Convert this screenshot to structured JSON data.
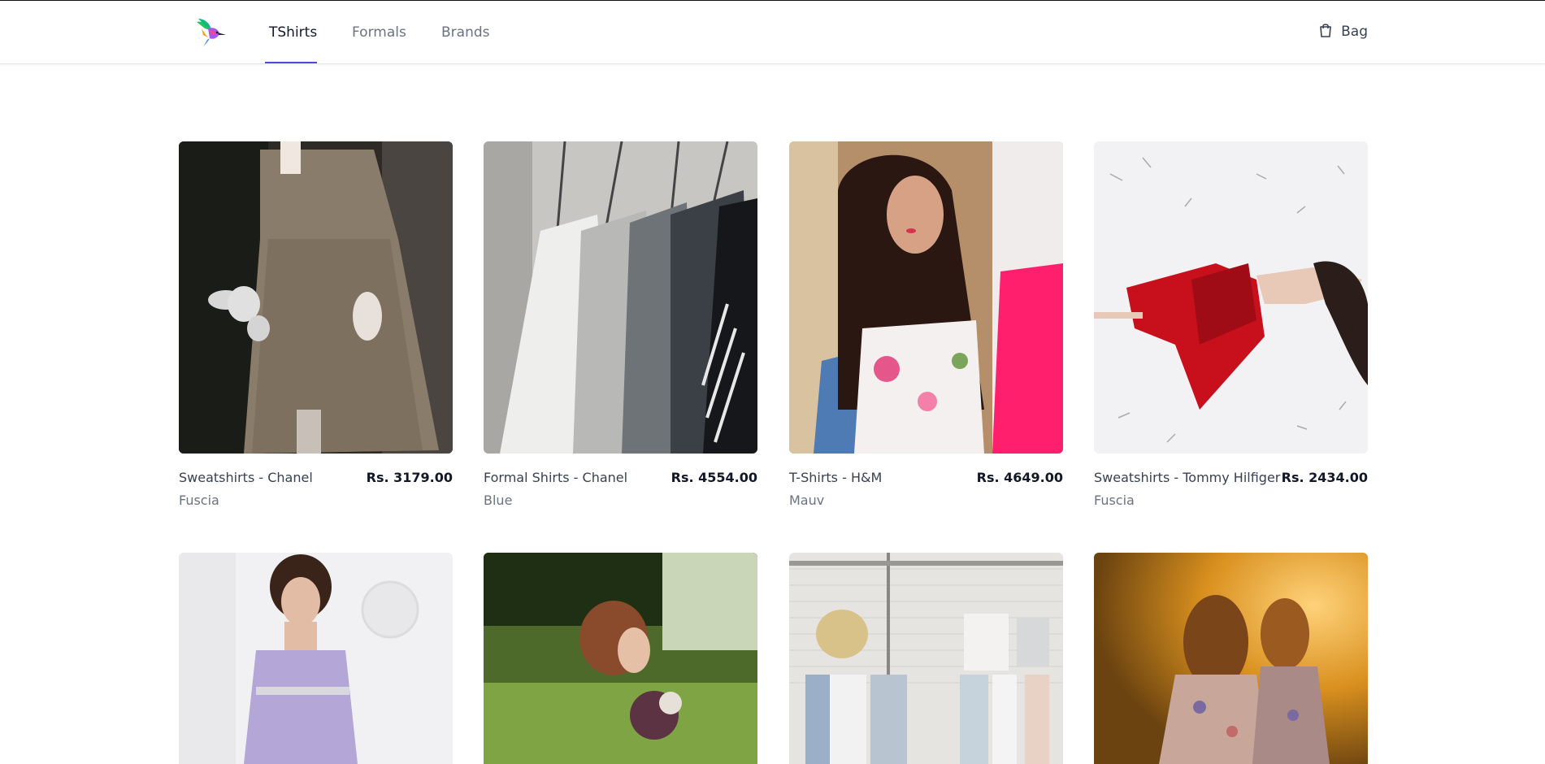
{
  "nav": {
    "links": [
      "TShirts",
      "Formals",
      "Brands"
    ],
    "bag_label": "Bag"
  },
  "products": [
    {
      "name": "Sweatshirts - Chanel",
      "price": "Rs. 3179.00",
      "color": "Fuscia",
      "image": "girl in linen dress holding stuffed bunny"
    },
    {
      "name": "Formal Shirts - Chanel",
      "price": "Rs. 4554.00",
      "color": "Blue",
      "image": "shirts on hangers"
    },
    {
      "name": "T-Shirts - H&M",
      "price": "Rs. 4649.00",
      "color": "Mauv",
      "image": "woman with long dark hair in floral top"
    },
    {
      "name": "Sweatshirts - Tommy Hilfiger",
      "price": "Rs. 2434.00",
      "color": "Fuscia",
      "image": "woman in red dress lying in snow"
    }
  ],
  "products_row2": [
    {
      "image": "woman in lavender strapless gown"
    },
    {
      "image": "bride with bouquet outdoors"
    },
    {
      "image": "clothes rack against white brick wall"
    },
    {
      "image": "two girls in sunset light"
    }
  ],
  "colors": {
    "accent": "#4f46e5",
    "text_dark": "#111827",
    "text_muted": "#6b7280"
  }
}
